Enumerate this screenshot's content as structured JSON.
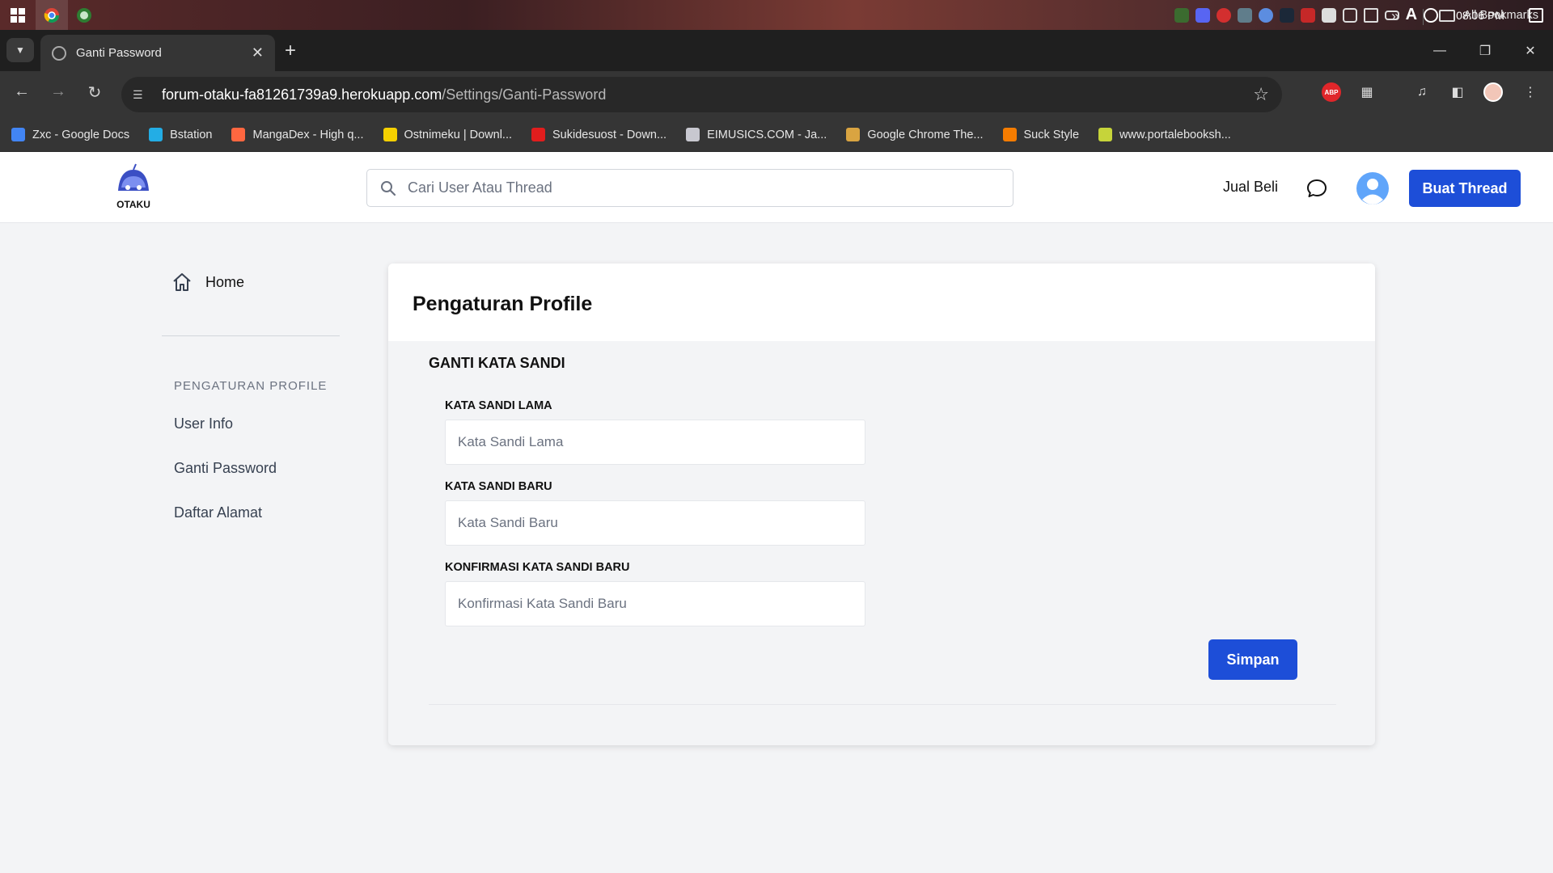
{
  "taskbar": {
    "clock": "08:06 PM"
  },
  "browser": {
    "tab_title": "Ganti Password",
    "url_host": "forum-otaku-fa81261739a9.herokuapp.com",
    "url_path": "/Settings/Ganti-Password",
    "extension_abp": "ABP",
    "bookmarks": [
      {
        "label": "Zxc - Google Docs",
        "color": "#4285f4"
      },
      {
        "label": "Bstation",
        "color": "#23ade5"
      },
      {
        "label": "MangaDex - High q...",
        "color": "#ff6740"
      },
      {
        "label": "Ostnimeku | Downl...",
        "color": "#f5d000"
      },
      {
        "label": "Sukidesuost - Down...",
        "color": "#e11d1d"
      },
      {
        "label": "EIMUSICS.COM - Ja...",
        "color": "#c8c8d0"
      },
      {
        "label": "Google Chrome The...",
        "color": "#d9a441"
      },
      {
        "label": "Suck Style",
        "color": "#f57c00"
      },
      {
        "label": "www.portalebooksh...",
        "color": "#c6d43a"
      }
    ],
    "all_bookmarks": "All Bookmarks"
  },
  "header": {
    "logo_text": "OTAKU",
    "search_placeholder": "Cari User Atau Thread",
    "jual_beli": "Jual Beli",
    "buat_thread": "Buat Thread",
    "primary_color": "#1d4ed8"
  },
  "sidebar": {
    "home": "Home",
    "section_title": "PENGATURAN PROFILE",
    "links": [
      "User Info",
      "Ganti Password",
      "Daftar Alamat"
    ]
  },
  "main": {
    "title": "Pengaturan Profile",
    "section_title": "GANTI KATA SANDI",
    "fields": [
      {
        "label": "KATA SANDI LAMA",
        "placeholder": "Kata Sandi Lama"
      },
      {
        "label": "KATA SANDI BARU",
        "placeholder": "Kata Sandi Baru"
      },
      {
        "label": "KONFIRMASI KATA SANDI BARU",
        "placeholder": "Konfirmasi Kata Sandi Baru"
      }
    ],
    "save_label": "Simpan"
  }
}
